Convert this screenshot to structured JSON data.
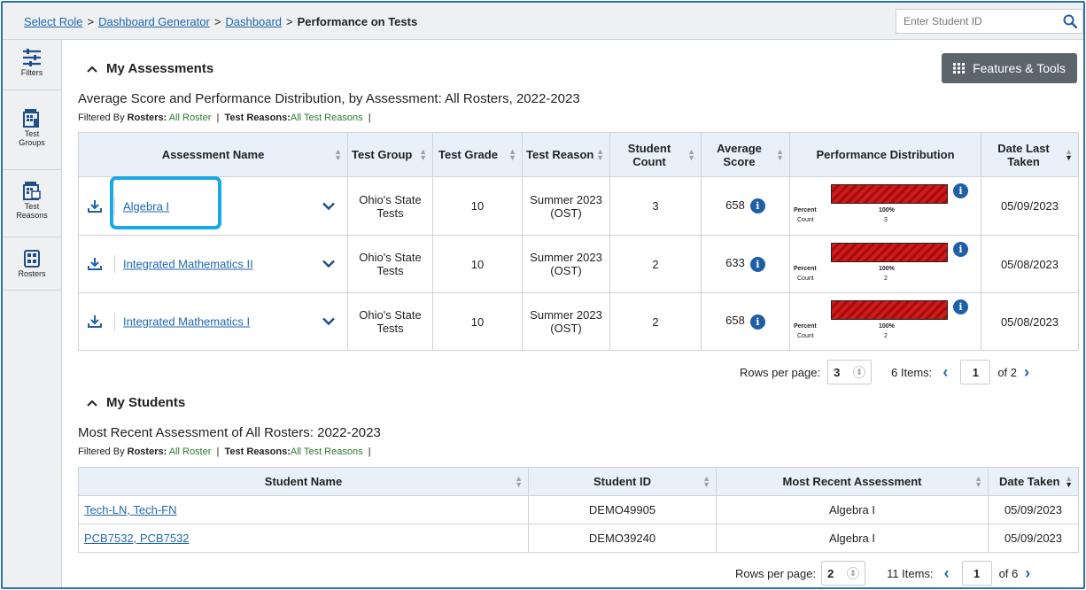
{
  "breadcrumb": {
    "items": [
      "Select Role",
      "Dashboard Generator",
      "Dashboard"
    ],
    "separator": ">",
    "current": "Performance on Tests"
  },
  "search": {
    "placeholder": "Enter Student ID"
  },
  "sidebar": {
    "items": [
      {
        "label": "Filters",
        "icon": "filters-icon"
      },
      {
        "label": "Test Groups",
        "icon": "test-groups-icon"
      },
      {
        "label": "Test Reasons",
        "icon": "test-reasons-icon"
      },
      {
        "label": "Rosters",
        "icon": "rosters-icon"
      }
    ]
  },
  "features_tools": {
    "label": "Features & Tools"
  },
  "assessments": {
    "heading": "My Assessments",
    "subtitle": "Average Score and Performance Distribution, by Assessment: All Rosters, 2022-2023",
    "filter": {
      "prefix": "Filtered By",
      "rosters_label": "Rosters:",
      "rosters_value": "All Roster",
      "reasons_label": "Test Reasons:",
      "reasons_value": "All Test Reasons"
    },
    "columns": [
      "Assessment Name",
      "Test Group",
      "Test Grade",
      "Test Reason",
      "Student Count",
      "Average Score",
      "Performance Distribution",
      "Date Last Taken"
    ],
    "rows": [
      {
        "name": "Algebra I",
        "group": "Ohio's State Tests",
        "grade": "10",
        "reason": "Summer 2023 (OST)",
        "count": "3",
        "score": "658",
        "perf_percent": "100%",
        "perf_count": "3",
        "date": "05/09/2023"
      },
      {
        "name": "Integrated Mathematics II",
        "group": "Ohio's State Tests",
        "grade": "10",
        "reason": "Summer 2023 (OST)",
        "count": "2",
        "score": "633",
        "perf_percent": "100%",
        "perf_count": "2",
        "date": "05/08/2023"
      },
      {
        "name": "Integrated Mathematics I",
        "group": "Ohio's State Tests",
        "grade": "10",
        "reason": "Summer 2023 (OST)",
        "count": "2",
        "score": "658",
        "perf_percent": "100%",
        "perf_count": "2",
        "date": "05/08/2023"
      }
    ],
    "perf_labels": {
      "percent": "Percent",
      "count": "Count"
    },
    "pager": {
      "rows_label": "Rows per page:",
      "rows_value": "3",
      "items": "6 Items:",
      "page": "1",
      "of": "of 2"
    }
  },
  "students": {
    "heading": "My Students",
    "subtitle": "Most Recent Assessment of All Rosters: 2022-2023",
    "filter": {
      "prefix": "Filtered By",
      "rosters_label": "Rosters:",
      "rosters_value": "All Roster",
      "reasons_label": "Test Reasons:",
      "reasons_value": "All Test Reasons"
    },
    "columns": [
      "Student Name",
      "Student ID",
      "Most Recent Assessment",
      "Date Taken"
    ],
    "rows": [
      {
        "name": "Tech-LN, Tech-FN",
        "id": "DEMO49905",
        "assessment": "Algebra I",
        "date": "05/09/2023"
      },
      {
        "name": "PCB7532, PCB7532",
        "id": "DEMO39240",
        "assessment": "Algebra I",
        "date": "05/09/2023"
      }
    ],
    "pager": {
      "rows_label": "Rows per page:",
      "rows_value": "2",
      "items": "11 Items:",
      "page": "1",
      "of": "of 6"
    }
  },
  "colors": {
    "accent": "#1f67b1",
    "highlight": "#1aa7e6",
    "bar": "#d11a1a",
    "header_bg": "#e8f1fa"
  }
}
